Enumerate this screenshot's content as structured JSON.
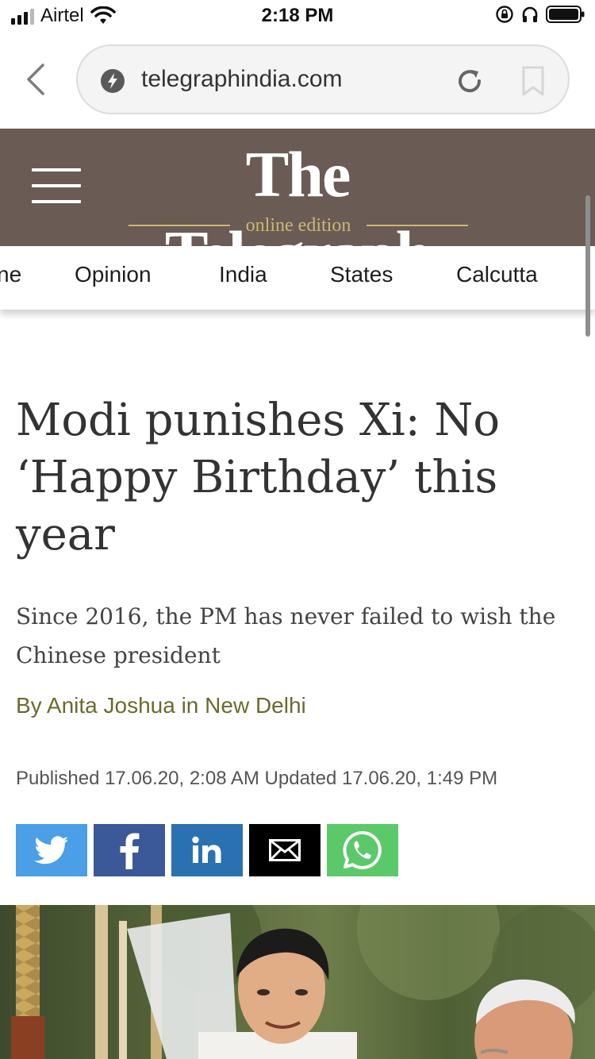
{
  "status_bar": {
    "carrier": "Airtel",
    "time": "2:18 PM",
    "signal_bars": 3,
    "signal_bars_total": 4,
    "icons": [
      "signal-icon",
      "wifi-icon",
      "rotation-lock-icon",
      "headphones-icon",
      "battery-icon"
    ]
  },
  "browser": {
    "url": "telegraphindia.com",
    "icons": [
      "back-arrow-icon",
      "site-info-icon",
      "reload-icon",
      "bookmark-icon"
    ]
  },
  "masthead": {
    "logo_title": "The Telegraph",
    "logo_edition": "online edition",
    "background": "#6b5b55",
    "accent": "#c9b873"
  },
  "nav": {
    "items": [
      "ne",
      "Opinion",
      "India",
      "States",
      "Calcutta"
    ]
  },
  "article": {
    "headline": "Modi punishes Xi: No ‘Happy Birthday’ this year",
    "subheadline": "Since 2016, the PM has never failed to wish the Chinese president",
    "byline": "By Anita Joshua in New Delhi",
    "published": "Published 17.06.20, 2:08 AM Updated 17.06.20, 1:49 PM",
    "byline_color": "#6b6a2f"
  },
  "share": {
    "buttons": [
      {
        "name": "twitter",
        "icon": "twitter-icon",
        "color": "#4a9fe6"
      },
      {
        "name": "facebook",
        "icon": "facebook-icon",
        "color": "#3b5998"
      },
      {
        "name": "linkedin",
        "icon": "linkedin-icon",
        "color": "#2a71b2"
      },
      {
        "name": "email",
        "icon": "mail-icon",
        "color": "#000000"
      },
      {
        "name": "whatsapp",
        "icon": "whatsapp-icon",
        "color": "#5bc96a"
      }
    ]
  }
}
